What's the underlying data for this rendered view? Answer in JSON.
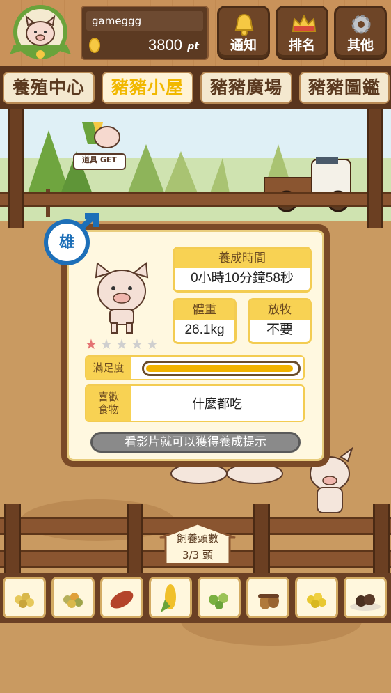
{
  "header": {
    "username": "gameggg",
    "points": "3800",
    "points_unit": "pt",
    "buttons": {
      "notice": "通知",
      "rank": "排名",
      "other": "其他"
    }
  },
  "tabs": [
    {
      "label": "養殖中心",
      "active": false
    },
    {
      "label": "豬豬小屋",
      "active": true
    },
    {
      "label": "豬豬廣場",
      "active": false
    },
    {
      "label": "豬豬圖鑑",
      "active": false
    }
  ],
  "item_badge": "道具 GET",
  "pig_info": {
    "gender_label": "雄",
    "raise_time": {
      "label": "養成時間",
      "value": "0小時10分鐘58秒"
    },
    "weight": {
      "label": "體重",
      "value": "26.1kg"
    },
    "grazing": {
      "label": "放牧",
      "value": "不要"
    },
    "stars_filled": 1,
    "stars_total": 5,
    "satisfaction": {
      "label": "滿足度",
      "level": 0.95
    },
    "favorite_food": {
      "label_line1": "喜歡",
      "label_line2": "食物",
      "value": "什麼都吃"
    },
    "hint_button": "看影片就可以獲得養成提示"
  },
  "head_count": {
    "label": "飼養頭數",
    "value": "3/3 頭"
  },
  "food_items": [
    "grain-mix-icon",
    "bean-mix-icon",
    "sweet-potato-icon",
    "corn-icon",
    "vegetable-icon",
    "acorn-icon",
    "soybean-icon",
    "truffle-icon"
  ],
  "colors": {
    "accent": "#f1b800",
    "wood": "#6b4024",
    "card_header": "#f8d253"
  }
}
